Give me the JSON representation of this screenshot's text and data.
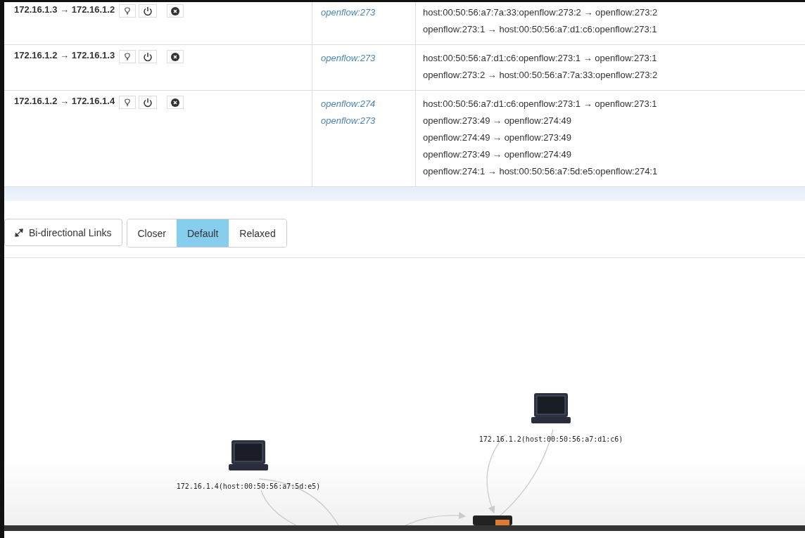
{
  "paths": [
    {
      "route": "172.16.1.3 → 172.16.1.2",
      "switches": [
        "openflow:273"
      ],
      "flows": [
        "host:00:50:56:a7:7a:33:openflow:273:2 → openflow:273:2",
        "openflow:273:1 → host:00:50:56:a7:d1:c6:openflow:273:1"
      ]
    },
    {
      "route": "172.16.1.2 → 172.16.1.3",
      "switches": [
        "openflow:273"
      ],
      "flows": [
        "host:00:50:56:a7:d1:c6:openflow:273:1 → openflow:273:1",
        "openflow:273:2 → host:00:50:56:a7:7a:33:openflow:273:2"
      ]
    },
    {
      "route": "172.16.1.2 → 172.16.1.4",
      "switches": [
        "openflow:274",
        "openflow:273"
      ],
      "flows": [
        "host:00:50:56:a7:d1:c6:openflow:273:1 → openflow:273:1",
        "openflow:273:49 → openflow:274:49",
        "openflow:274:49 → openflow:273:49",
        "openflow:273:49 → openflow:274:49",
        "openflow:274:1 → host:00:50:56:a7:5d:e5:openflow:274:1"
      ]
    }
  ],
  "toolbar": {
    "bidirectional": "Bi-directional Links",
    "spacing": [
      {
        "label": "Closer",
        "selected": false
      },
      {
        "label": "Default",
        "selected": true
      },
      {
        "label": "Relaxed",
        "selected": false
      }
    ]
  },
  "topology": {
    "nodes": [
      {
        "kind": "host",
        "label": "172.16.1.4(host:00:50:56:a7:5d:e5)"
      },
      {
        "kind": "host",
        "label": "172.16.1.2(host:00:50:56:a7:d1:c6)"
      },
      {
        "kind": "switch"
      }
    ]
  }
}
